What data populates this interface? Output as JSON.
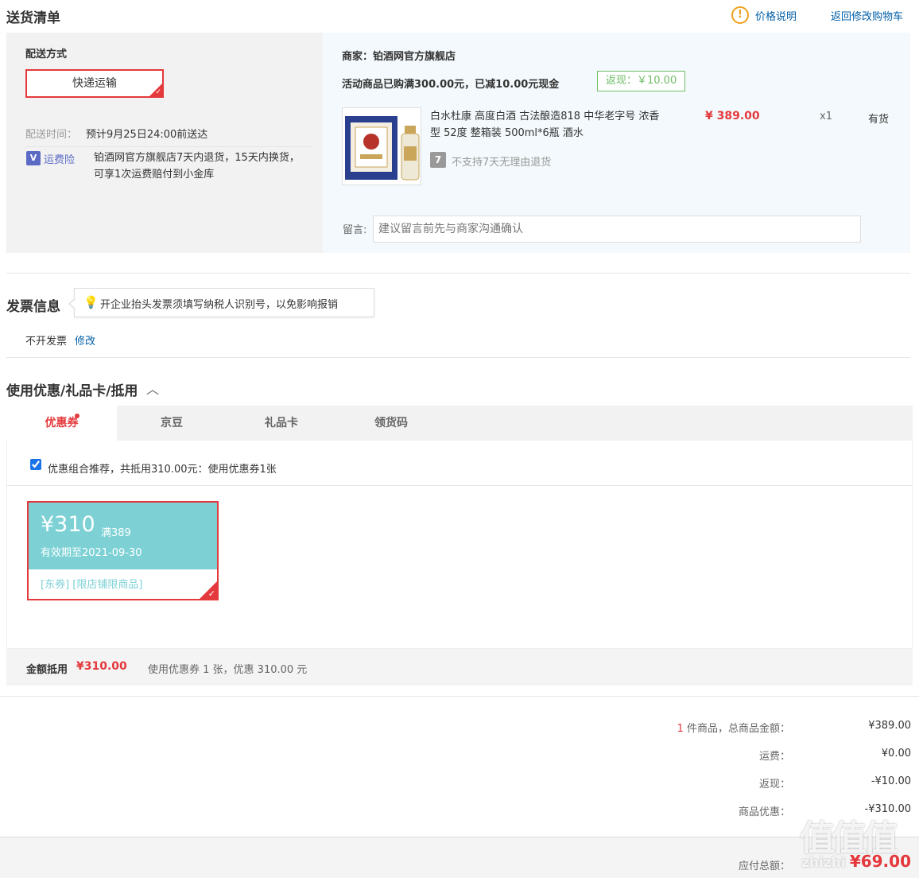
{
  "header": {
    "title": "送货清单",
    "price_info": "价格说明",
    "back_to_cart": "返回修改购物车"
  },
  "shipping": {
    "method_label": "配送方式",
    "method_value": "快递运输",
    "time_label": "配送时间：",
    "time_value": "预计9月25日24:00前送达",
    "insurance_label": "运费险",
    "insurance_text": "铂酒网官方旗舰店7天内退货，15天内换货，可享1次运费赔付到小金库"
  },
  "shop": {
    "merchant_label": "商家：",
    "merchant_name": "铂酒网官方旗舰店",
    "promo_text": "活动商品已购满300.00元，已减10.00元现金",
    "return_tag": "返现：￥10.00",
    "product_name": "白水杜康 高度白酒 古法酿造818 中华老字号 浓香型 52度 整箱装 500ml*6瓶 酒水",
    "product_price": "¥ 389.00",
    "product_qty": "x1",
    "product_stock": "有货",
    "no_return_text": "不支持7天无理由退货",
    "memo_label": "留言:",
    "memo_placeholder": "建议留言前先与商家沟通确认"
  },
  "invoice": {
    "title": "发票信息",
    "tip": "开企业抬头发票须填写纳税人识别号，以免影响报销",
    "status": "不开发票",
    "edit": "修改"
  },
  "discount": {
    "title": "使用优惠/礼品卡/抵用",
    "tabs": [
      {
        "label": "优惠券"
      },
      {
        "label": "京豆"
      },
      {
        "label": "礼品卡"
      },
      {
        "label": "领货码"
      }
    ],
    "recommend_text": "优惠组合推荐，共抵用310.00元：使用优惠券1张",
    "coupon": {
      "amount": "¥310",
      "condition": "满389",
      "expiry": "有效期至2021-09-30",
      "tags": "[东券]  [限店铺限商品]"
    },
    "summary_label": "金额抵用",
    "summary_amount": "¥310.00",
    "summary_text": "使用优惠券 1 张，优惠 310.00 元"
  },
  "totals": {
    "count": "1",
    "count_text": " 件商品，总商品金额：",
    "goods_total": "¥389.00",
    "freight_label": "运费：",
    "freight": "¥0.00",
    "cashback_label": "返现：",
    "cashback": "-¥10.00",
    "discount_label": "商品优惠：",
    "discount": "-¥310.00",
    "payable_label": "应付总额：",
    "payable": "¥69.00"
  },
  "watermark": {
    "logo": "值",
    "domain": "zhizhi"
  }
}
